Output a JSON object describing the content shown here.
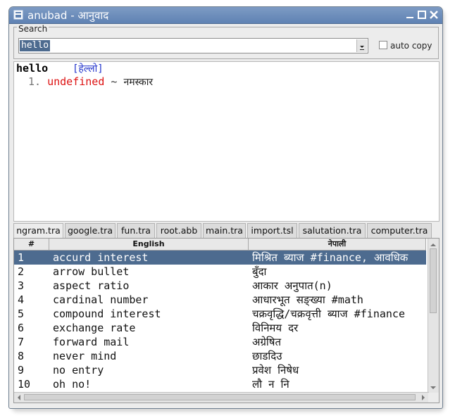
{
  "window": {
    "title": "anubad - आनुवाद"
  },
  "search": {
    "legend": "Search",
    "value": "hello",
    "auto_copy_label": "auto copy",
    "auto_copy_checked": false
  },
  "result": {
    "word": "hello",
    "transliteration": "[हेल्लो]",
    "definitions": [
      {
        "num": "1.",
        "pos": "undefined",
        "sep": "~",
        "meaning": "नमस्कार"
      }
    ]
  },
  "tabs": [
    "ngram.tra",
    "google.tra",
    "fun.tra",
    "root.abb",
    "main.tra",
    "import.tsl",
    "salutation.tra",
    "computer.tra"
  ],
  "active_tab": "ngram.tra",
  "table": {
    "headers": [
      "#",
      "English",
      "नेपाली"
    ],
    "rows": [
      [
        "1",
        "accurd interest",
        "मिश्रित ब्याज #finance, आवधिक"
      ],
      [
        "2",
        "arrow bullet",
        "बुँदा"
      ],
      [
        "3",
        "aspect ratio",
        "आकार अनुपात(n)"
      ],
      [
        "4",
        "cardinal number",
        "आधारभूत सङ्ख्या #math"
      ],
      [
        "5",
        "compound interest",
        "चक्रवृद्धि/चक्रवृत्ती ब्याज #finance"
      ],
      [
        "6",
        "exchange rate",
        "विनिमय दर"
      ],
      [
        "7",
        "forward mail",
        "अग्रेषित"
      ],
      [
        "8",
        "never mind",
        "छाडदिउ"
      ],
      [
        "9",
        "no entry",
        "प्रवेश निषेध"
      ],
      [
        "10",
        "oh no!",
        "लौ न नि"
      ]
    ],
    "selected_row": 0
  },
  "colors": {
    "titlebar": "#6e8fbd",
    "selection": "#4d6b8f",
    "pos": "#dd1111",
    "transliteration": "#2233cc"
  }
}
